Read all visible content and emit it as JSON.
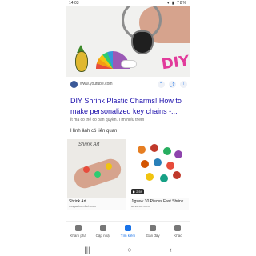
{
  "status": {
    "time": "14:03",
    "indicators": "▾ ▮ 78%"
  },
  "source": {
    "url": "www.youtube.com",
    "actions": [
      "chevron-up-icon",
      "share-icon",
      "more-icon"
    ]
  },
  "result": {
    "title": "DIY Shrink Plastic Charms! How to make personalized key chains -...",
    "subtitle": "Ít mà có thể có bản quyền. Tìm hiểu thêm"
  },
  "related_label": "Hình ảnh có liên quan",
  "cards": [
    {
      "caption": "Shrink Art",
      "label": "Shrink Art",
      "sub": "magazineofart.com"
    },
    {
      "tag": "▶ 2:59",
      "label": "Jigsaw 30 Pieces Fast Shrink",
      "sub": "amazon.com"
    }
  ],
  "nav": [
    {
      "label": "Khám phá",
      "active": false
    },
    {
      "label": "Cập nhật",
      "active": false
    },
    {
      "label": "Tìm kiếm",
      "active": true
    },
    {
      "label": "Gần đây",
      "active": false
    },
    {
      "label": "Khác",
      "active": false
    }
  ],
  "system_buttons": [
    "|||",
    "○",
    "‹"
  ],
  "colors": {
    "link": "#1a0dab",
    "accent": "#1a73e8",
    "diy": "#e23b9b"
  }
}
